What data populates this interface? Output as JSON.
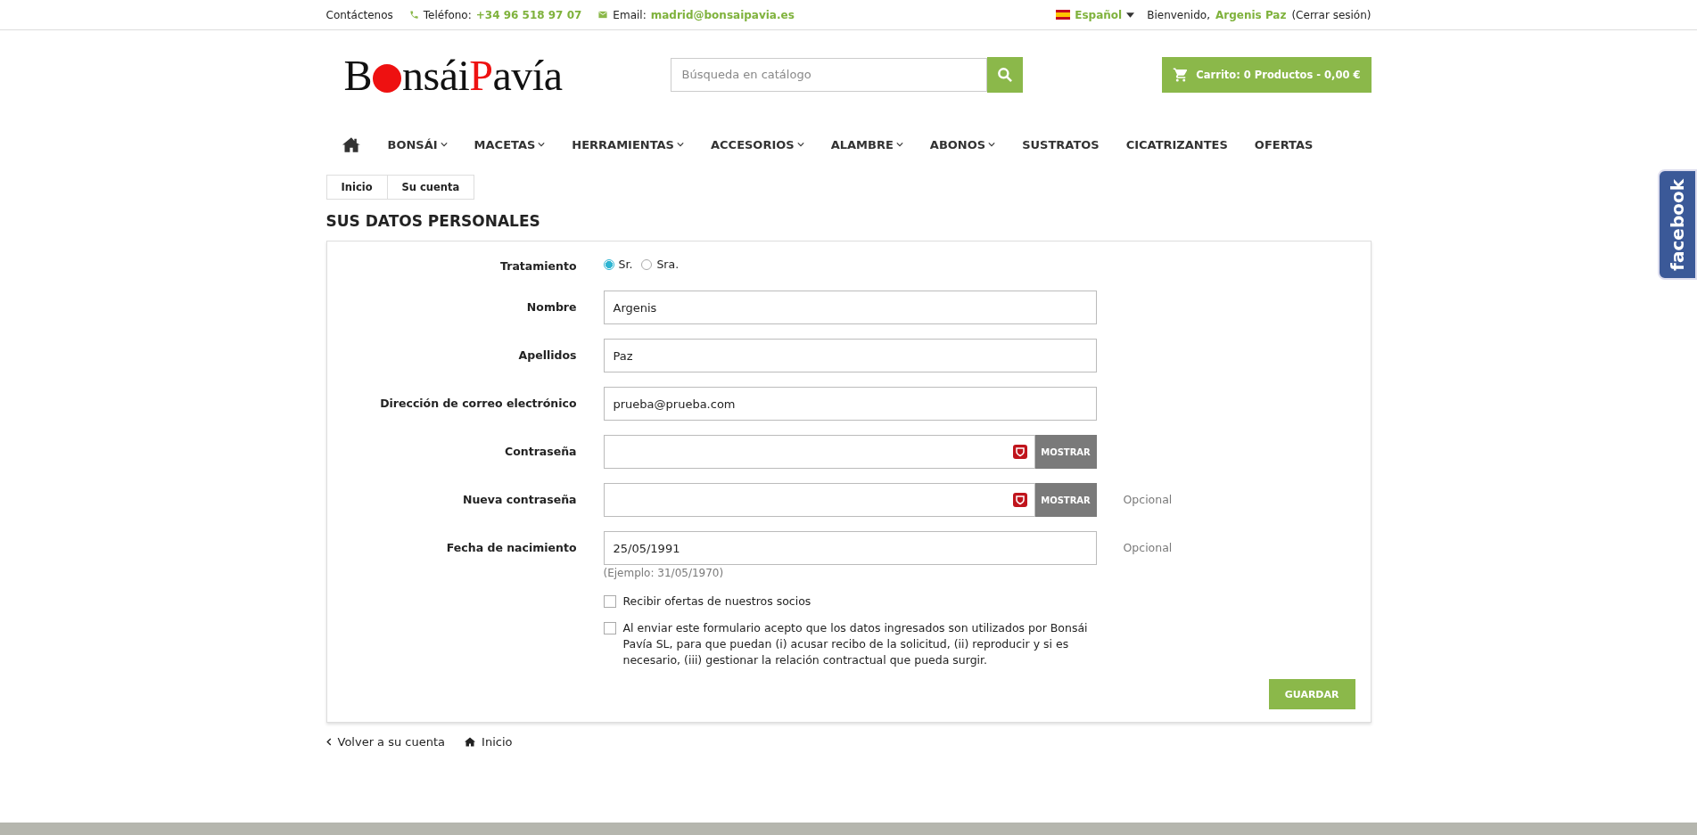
{
  "topbar": {
    "contact": "Contáctenos",
    "phone_label": "Teléfono:",
    "phone": "+34 96 518 97 07",
    "email_label": "Email:",
    "email": "madrid@bonsaipavia.es",
    "language": "Español",
    "welcome": "Bienvenido,",
    "user": "Argenis Paz",
    "logout": "(Cerrar sesión)"
  },
  "logo": {
    "first": "B",
    "middle": "nsái",
    "accent": "P",
    "last": "avía"
  },
  "search": {
    "placeholder": "Búsqueda en catálogo"
  },
  "cart": {
    "label": "Carrito: 0 Productos - 0,00 €"
  },
  "nav": [
    {
      "label": "BONSÁI",
      "has_submenu": true
    },
    {
      "label": "MACETAS",
      "has_submenu": true
    },
    {
      "label": "HERRAMIENTAS",
      "has_submenu": true
    },
    {
      "label": "ACCESORIOS",
      "has_submenu": true
    },
    {
      "label": "ALAMBRE",
      "has_submenu": true
    },
    {
      "label": "ABONOS",
      "has_submenu": true
    },
    {
      "label": "SUSTRATOS",
      "has_submenu": false
    },
    {
      "label": "CICATRIZANTES",
      "has_submenu": false
    },
    {
      "label": "OFERTAS",
      "has_submenu": false
    }
  ],
  "breadcrumb": [
    "Inicio",
    "Su cuenta"
  ],
  "title": "SUS DATOS PERSONALES",
  "form": {
    "rows": [
      {
        "kind": "radio",
        "label": "Tratamiento",
        "options": [
          {
            "label": "Sr.",
            "selected": true
          },
          {
            "label": "Sra.",
            "selected": false
          }
        ]
      },
      {
        "kind": "text",
        "label": "Nombre",
        "value": "Argenis"
      },
      {
        "kind": "text",
        "label": "Apellidos",
        "value": "Paz"
      },
      {
        "kind": "text",
        "label": "Dirección de correo electrónico",
        "value": "prueba@prueba.com"
      },
      {
        "kind": "password",
        "label": "Contraseña",
        "button": "MOSTRAR"
      },
      {
        "kind": "password",
        "label": "Nueva contraseña",
        "button": "MOSTRAR",
        "note": "Opcional"
      },
      {
        "kind": "text",
        "label": "Fecha de nacimiento",
        "value": "25/05/1991",
        "note": "Opcional",
        "hint": "(Ejemplo: 31/05/1970)"
      }
    ],
    "checkboxes": [
      {
        "label": "Recibir ofertas de nuestros socios",
        "checked": false
      },
      {
        "label": "Al enviar este formulario acepto que los datos ingresados son utilizados por Bonsái Pavía SL, para que puedan (i) acusar recibo de la solicitud, (ii) reproducir y si es necesario, (iii) gestionar la relación contractual que pueda surgir.",
        "checked": false
      }
    ],
    "save": "GUARDAR"
  },
  "footer_links": [
    {
      "kind": "back",
      "label": "Volver a su cuenta"
    },
    {
      "kind": "home",
      "label": "Inicio"
    }
  ],
  "facebook": "facebook"
}
